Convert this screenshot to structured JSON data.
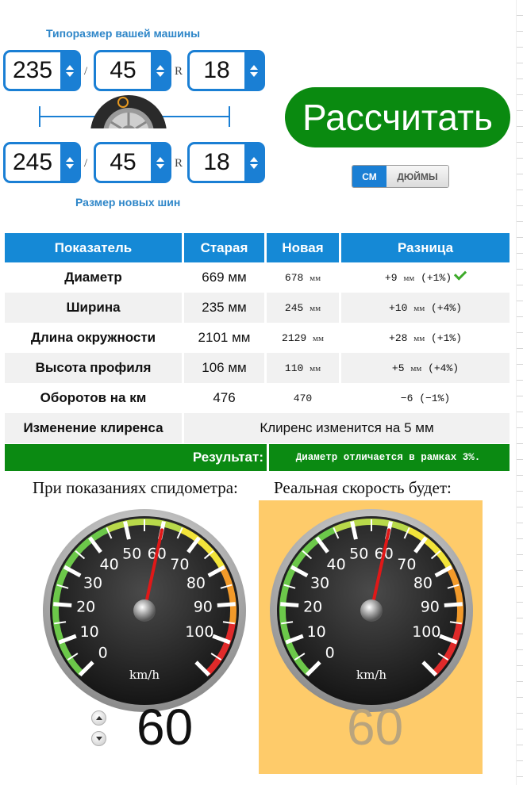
{
  "current_size": {
    "title": "Типоразмер вашей машины",
    "width": "235",
    "profile": "45",
    "rim": "18"
  },
  "new_size": {
    "title": "Размер новых шин",
    "width": "245",
    "profile": "45",
    "rim": "18"
  },
  "separators": {
    "slash": "/",
    "radial": "R"
  },
  "calculate_label": "Рассчитать",
  "units": {
    "cm": "СМ",
    "inches": "ДЮЙМЫ",
    "selected": "cm"
  },
  "table": {
    "headers": [
      "Показатель",
      "Старая",
      "Новая",
      "Разница"
    ],
    "rows": [
      {
        "label": "Диаметр",
        "old": "669 мм",
        "new_val": "678",
        "new_unit": "мм",
        "diff_a": "+9",
        "diff_unit": "мм",
        "diff_b": "(+1%)",
        "ok": true
      },
      {
        "label": "Ширина",
        "old": "235 мм",
        "new_val": "245",
        "new_unit": "мм",
        "diff_a": "+10",
        "diff_unit": "мм",
        "diff_b": "(+4%)"
      },
      {
        "label": "Длина окружности",
        "old": "2101 мм",
        "new_val": "2129",
        "new_unit": "мм",
        "diff_a": "+28",
        "diff_unit": "мм",
        "diff_b": "(+1%)"
      },
      {
        "label": "Высота профиля",
        "old": "106 мм",
        "new_val": "110",
        "new_unit": "мм",
        "diff_a": "+5",
        "diff_unit": "мм",
        "diff_b": "(+4%)"
      },
      {
        "label": "Оборотов на км",
        "old": "476",
        "new_val": "470",
        "new_unit": "",
        "diff_a": "−6",
        "diff_unit": "",
        "diff_b": "(−1%)"
      }
    ],
    "clearance_label": "Изменение клиренса",
    "clearance_text": "Клиренс изменится на 5 мм"
  },
  "result": {
    "label": "Результат:",
    "text": "Диаметр отличается в рамках 3%."
  },
  "speedometer": {
    "caption_input": "При показаниях спидометра:",
    "caption_real": "Реальная скорость будет:",
    "unit": "km/h",
    "ticks": [
      "0",
      "10",
      "20",
      "30",
      "40",
      "50",
      "60",
      "70",
      "80",
      "90",
      "100"
    ],
    "max": 110,
    "input_value": "60",
    "real_value": "60",
    "input_speed": 60,
    "real_speed": 60
  },
  "colors": {
    "accent_blue": "#1589d6",
    "green": "#0a8a10",
    "real_bg": "#fecb6a"
  }
}
